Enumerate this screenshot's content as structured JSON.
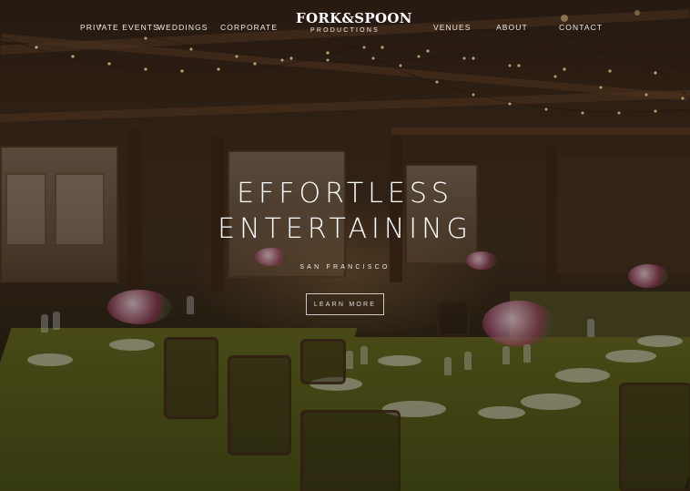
{
  "nav": {
    "left": [
      "PRIVATE EVENTS",
      "WEDDINGS",
      "CORPORATE"
    ],
    "right": [
      "VENUES",
      "ABOUT",
      "CONTACT"
    ]
  },
  "logo": {
    "main": "FORK&SPOON",
    "sub": "PRODUCTIONS"
  },
  "hero": {
    "headline_line1": "EFFORTLESS",
    "headline_line2": "ENTERTAINING",
    "location": "SAN FRANCISCO",
    "cta_label": "LEARN MORE"
  }
}
